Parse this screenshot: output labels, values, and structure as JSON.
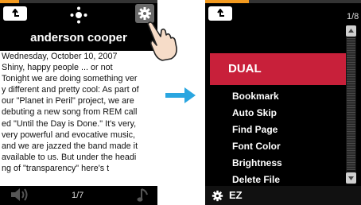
{
  "left_screen": {
    "progress": 0.12,
    "title": "anderson cooper",
    "text_lines": [
      "Wednesday, October 10, 2007",
      "Shiny, happy people ... or not",
      "Tonight we are doing something ver",
      "y different and pretty cool: As part of",
      " our \"Planet in Peril\" project, we are",
      "debuting a new song from REM call",
      "ed \"Until the Day is Done.\" It's very,",
      "very powerful and evocative music,",
      "and we are jazzed the band made it",
      " available to us. But under the headi",
      "ng of \"transparency\" here's t"
    ],
    "page": "1/7",
    "icons": [
      "back-arrow-icon",
      "dpad-icon",
      "gear-icon",
      "hand-pointer-icon",
      "speaker-icon",
      "music-note-icon"
    ]
  },
  "arrow": {
    "color": "#2aa6e0",
    "icon": "right-arrow-icon"
  },
  "right_screen": {
    "progress": 0.28,
    "page": "1/8",
    "highlight_color": "#c8203a",
    "selected": "DUAL",
    "menu_items": [
      "Bookmark",
      "Auto Skip",
      "Find Page",
      "Font Color",
      "Brightness",
      "Delete File"
    ],
    "bottom_label": "EZ",
    "icons": [
      "back-arrow-icon",
      "scroll-up-icon",
      "scroll-down-icon",
      "gear-icon"
    ]
  }
}
